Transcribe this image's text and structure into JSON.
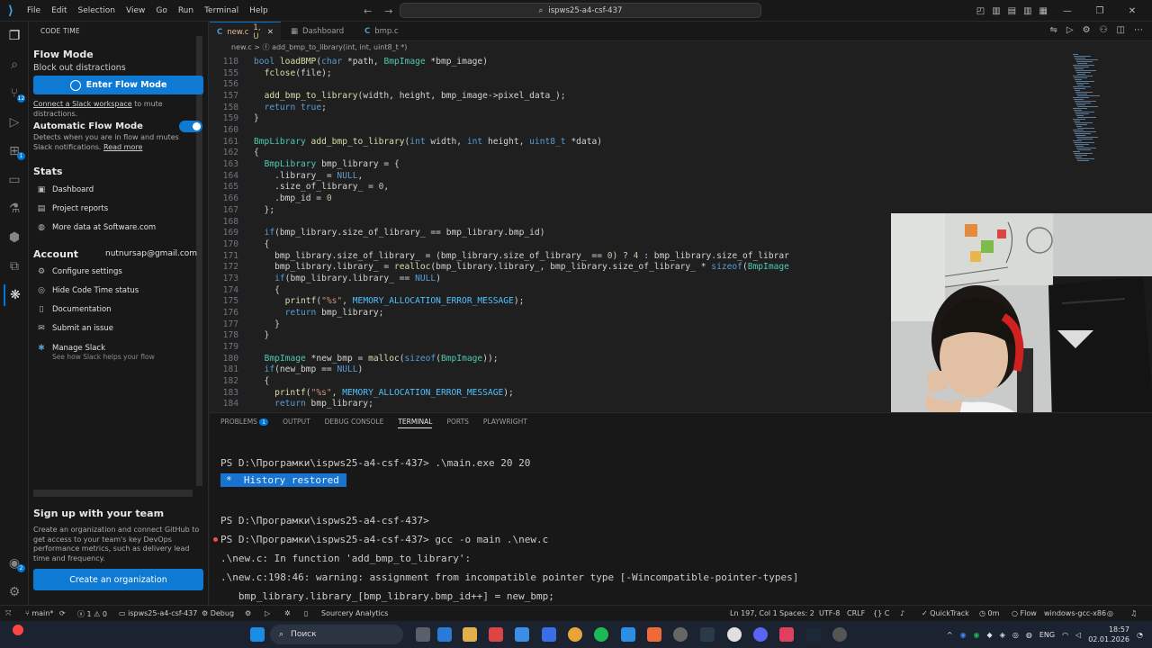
{
  "titlebar": {
    "menu": [
      "File",
      "Edit",
      "Selection",
      "View",
      "Go",
      "Run",
      "Terminal",
      "Help"
    ],
    "search": "ispws25-a4-csf-437"
  },
  "sidebar": {
    "title": "CODE TIME",
    "flow_title": "Flow Mode",
    "flow_sub": "Block out distractions",
    "enter_flow": "Enter Flow Mode",
    "slack_link": "Connect a Slack workspace",
    "slack_rest": " to mute distractions.",
    "auto_title": "Automatic Flow Mode",
    "auto_desc": "Detects when you are in flow and mutes Slack notifications. ",
    "read_more": "Read more",
    "stats_title": "Stats",
    "dashboard": "Dashboard",
    "project_reports": "Project reports",
    "more_data": "More data at Software.com",
    "account_title": "Account",
    "email": "nutnursap@gmail.com",
    "configure": "Configure settings",
    "hide_status": "Hide Code Time status",
    "documentation": "Documentation",
    "submit_issue": "Submit an issue",
    "manage_slack": "Manage Slack",
    "manage_slack_sub": "See how Slack helps your flow",
    "signup_title": "Sign up with your team",
    "signup_desc": "Create an organization and connect GitHub to get access to your team's key DevOps performance metrics, such as delivery lead time and frequency.",
    "create_org": "Create an organization"
  },
  "activity": {
    "badge_scm": "12",
    "badge_ext": "1",
    "badge_account": "2"
  },
  "tabs": [
    {
      "label": "new.c",
      "status": "1, U"
    },
    {
      "label": "Dashboard"
    },
    {
      "label": "bmp.c"
    }
  ],
  "breadcrumb": "new.c  >  ⓕ add_bmp_to_library(int, int, uint8_t *)",
  "code": [
    {
      "n": "118",
      "t": "bool loadBMP(char *path, BmpImage *bmp_image)"
    },
    {
      "n": "155",
      "t": "  fclose(file);"
    },
    {
      "n": "156",
      "t": ""
    },
    {
      "n": "157",
      "t": "  add_bmp_to_library(width, height, bmp_image->pixel_data_);"
    },
    {
      "n": "158",
      "t": "  return true;"
    },
    {
      "n": "159",
      "t": "}"
    },
    {
      "n": "160",
      "t": ""
    },
    {
      "n": "161",
      "t": "BmpLibrary add_bmp_to_library(int width, int height, uint8_t *data)"
    },
    {
      "n": "162",
      "t": "{"
    },
    {
      "n": "163",
      "t": "  BmpLibrary bmp_library = {"
    },
    {
      "n": "164",
      "t": "    .library_ = NULL,"
    },
    {
      "n": "165",
      "t": "    .size_of_library_ = 0,"
    },
    {
      "n": "166",
      "t": "    .bmp_id = 0"
    },
    {
      "n": "167",
      "t": "  };"
    },
    {
      "n": "168",
      "t": ""
    },
    {
      "n": "169",
      "t": "  if(bmp_library.size_of_library_ == bmp_library.bmp_id)"
    },
    {
      "n": "170",
      "t": "  {"
    },
    {
      "n": "171",
      "t": "    bmp_library.size_of_library_ = (bmp_library.size_of_library_ == 0) ? 4 : bmp_library.size_of_librar"
    },
    {
      "n": "172",
      "t": "    bmp_library.library_ = realloc(bmp_library.library_, bmp_library.size_of_library_ * sizeof(BmpImage"
    },
    {
      "n": "173",
      "t": "    if(bmp_library.library_ == NULL)"
    },
    {
      "n": "174",
      "t": "    {"
    },
    {
      "n": "175",
      "t": "      printf(\"%s\", MEMORY_ALLOCATION_ERROR_MESSAGE);"
    },
    {
      "n": "176",
      "t": "      return bmp_library;"
    },
    {
      "n": "177",
      "t": "    }"
    },
    {
      "n": "178",
      "t": "  }"
    },
    {
      "n": "179",
      "t": ""
    },
    {
      "n": "180",
      "t": "  BmpImage *new_bmp = malloc(sizeof(BmpImage));"
    },
    {
      "n": "181",
      "t": "  if(new_bmp == NULL)"
    },
    {
      "n": "182",
      "t": "  {"
    },
    {
      "n": "183",
      "t": "    printf(\"%s\", MEMORY_ALLOCATION_ERROR_MESSAGE);"
    },
    {
      "n": "184",
      "t": "    return bmp_library;"
    }
  ],
  "panel": {
    "tabs": [
      "PROBLEMS",
      "OUTPUT",
      "DEBUG CONSOLE",
      "TERMINAL",
      "PORTS",
      "PLAYWRIGHT"
    ],
    "problems_badge": "1",
    "terminal": [
      "PS D:\\Програмки\\ispws25-a4-csf-437> .\\main.exe 20 20",
      "*  History restored",
      "PS D:\\Програмки\\ispws25-a4-csf-437>",
      "PS D:\\Програмки\\ispws25-a4-csf-437> gcc -o main .\\new.c",
      ".\\new.c: In function 'add_bmp_to_library':",
      ".\\new.c:198:46: warning: assignment from incompatible pointer type [-Wincompatible-pointer-types]",
      "   bmp_library.library_[bmp_library.bmp_id++] = new_bmp;"
    ]
  },
  "statusbar": {
    "branch": "main*",
    "errors": "1",
    "warnings": "0",
    "folder": "ispws25-a4-csf-437",
    "debug": "Debug",
    "sourcery": "Sourcery Analytics",
    "position": "Ln 197, Col 1",
    "spaces": "Spaces: 2",
    "encoding": "UTF-8",
    "eol": "CRLF",
    "lang": "C",
    "quicktrack": "QuickTrack",
    "time": "0m",
    "flow": "Flow",
    "config": "windows-gcc-x86"
  },
  "taskbar": {
    "search": "Поиск",
    "lang": "ENG",
    "clock_time": "18:57",
    "clock_date": "02.01.2026"
  }
}
